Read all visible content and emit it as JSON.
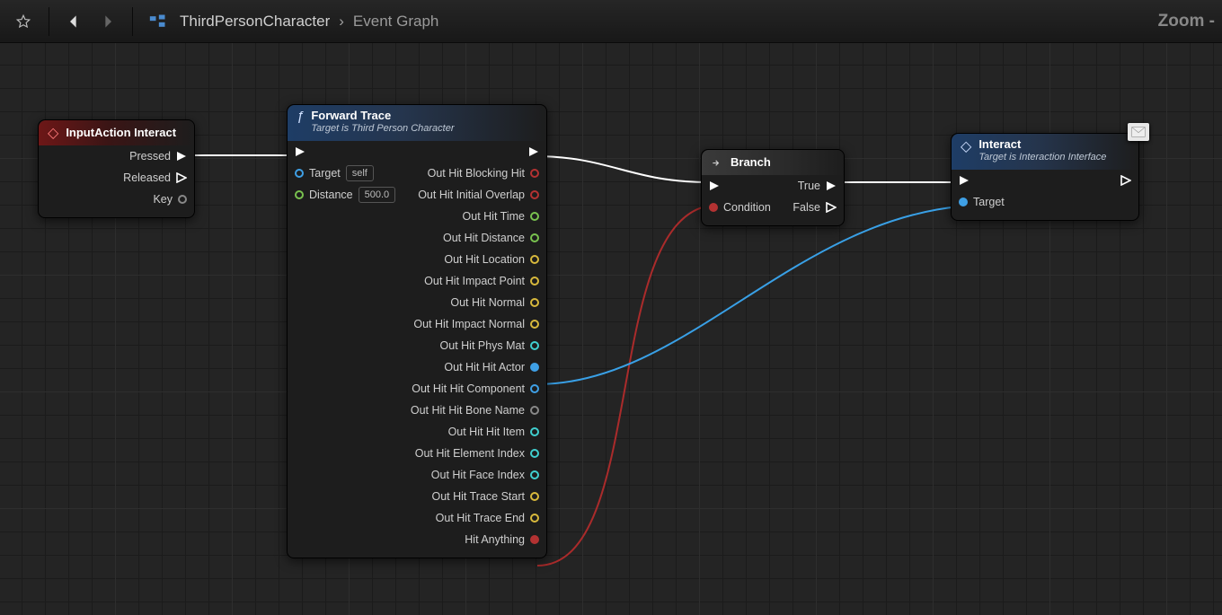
{
  "toolbar": {
    "crumb1": "ThirdPersonCharacter",
    "crumb2": "Event Graph",
    "zoom": "Zoom -"
  },
  "nodes": {
    "inputaction": {
      "title": "InputAction Interact",
      "pressed": "Pressed",
      "released": "Released",
      "key": "Key"
    },
    "forward": {
      "title": "Forward Trace",
      "sub": "Target is Third Person Character",
      "target_lbl": "Target",
      "target_val": "self",
      "distance_lbl": "Distance",
      "distance_val": "500.0",
      "outs": [
        "Out Hit Blocking Hit",
        "Out Hit Initial Overlap",
        "Out Hit Time",
        "Out Hit Distance",
        "Out Hit Location",
        "Out Hit Impact Point",
        "Out Hit Normal",
        "Out Hit Impact Normal",
        "Out Hit Phys Mat",
        "Out Hit Hit Actor",
        "Out Hit Hit Component",
        "Out Hit Hit Bone Name",
        "Out Hit Hit Item",
        "Out Hit Element Index",
        "Out Hit Face Index",
        "Out Hit Trace Start",
        "Out Hit Trace End",
        "Hit Anything"
      ],
      "out_colors": [
        "c-red",
        "c-red",
        "c-green",
        "c-green",
        "c-yellow",
        "c-yellow",
        "c-yellow",
        "c-yellow",
        "c-cyan",
        "c-blue",
        "c-blue",
        "c-grey",
        "c-cyan",
        "c-cyan",
        "c-cyan",
        "c-yellow",
        "c-yellow",
        "c-red"
      ]
    },
    "branch": {
      "title": "Branch",
      "condition": "Condition",
      "true": "True",
      "false": "False"
    },
    "interact": {
      "title": "Interact",
      "sub": "Target is Interaction Interface",
      "target_lbl": "Target"
    }
  }
}
